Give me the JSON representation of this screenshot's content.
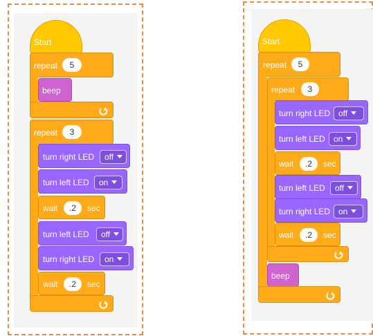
{
  "colors": {
    "control": "#ffab19",
    "control_border": "#d9900a",
    "hat": "#ffc800",
    "motion": "#9966ff",
    "motion_border": "#7d4fe0",
    "sound": "#cf63cf",
    "sound_border": "#b347b3",
    "panel_border": "#f0883a",
    "panel_bg": "#f4f4f4"
  },
  "left_program": {
    "start": "Start",
    "loop1": {
      "label": "repeat",
      "count": "5",
      "repeat_icon": "loop-arrow-icon"
    },
    "beep": "beep",
    "loop2": {
      "label": "repeat",
      "count": "3",
      "repeat_icon": "loop-arrow-icon"
    },
    "b1": {
      "text": "turn right LED",
      "value": "off"
    },
    "b2": {
      "text": "turn left LED",
      "value": "on"
    },
    "w1": {
      "pre": "wait",
      "value": ".2",
      "post": "sec"
    },
    "b3": {
      "text": "turn left LED",
      "value": "off"
    },
    "b4": {
      "text": "turn right LED",
      "value": "on"
    },
    "w2": {
      "pre": "wait",
      "value": ".2",
      "post": "sec"
    }
  },
  "right_program": {
    "start": "Start",
    "loop1": {
      "label": "repeat",
      "count": "5",
      "repeat_icon": "loop-arrow-icon"
    },
    "loop2": {
      "label": "repeat",
      "count": "3",
      "repeat_icon": "loop-arrow-icon"
    },
    "b1": {
      "text": "turn right LED",
      "value": "off"
    },
    "b2": {
      "text": "turn left LED",
      "value": "on"
    },
    "w1": {
      "pre": "wait",
      "value": ".2",
      "post": "sec"
    },
    "b3": {
      "text": "turn left LED",
      "value": "off"
    },
    "b4": {
      "text": "turn right LED",
      "value": "on"
    },
    "w2": {
      "pre": "wait",
      "value": ".2",
      "post": "sec"
    },
    "beep": "beep"
  }
}
